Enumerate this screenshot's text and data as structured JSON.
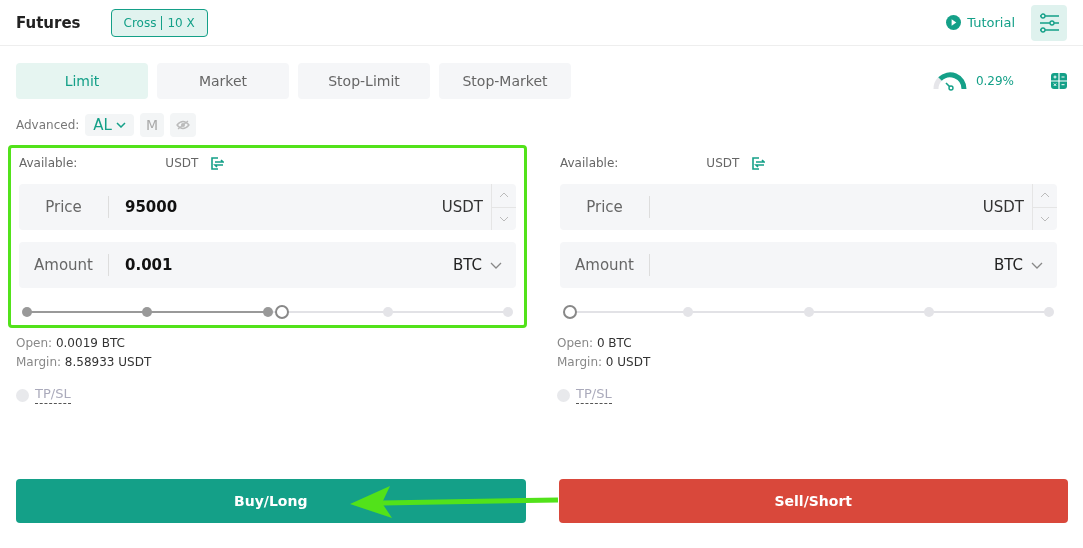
{
  "header": {
    "title": "Futures",
    "margin_mode": "Cross",
    "leverage": "10 X",
    "tutorial": "Tutorial"
  },
  "order_types": [
    {
      "label": "Limit",
      "selected": true
    },
    {
      "label": "Market",
      "selected": false
    },
    {
      "label": "Stop-Limit",
      "selected": false
    },
    {
      "label": "Stop-Market",
      "selected": false
    }
  ],
  "fee_rate": "0.29%",
  "advanced": {
    "label": "Advanced:",
    "mode": "AL",
    "option": "M"
  },
  "panels": [
    {
      "highlighted": true,
      "available_label": "Available:",
      "available_unit": "USDT",
      "price_label": "Price",
      "price_value": "95000",
      "price_unit": "USDT",
      "amount_label": "Amount",
      "amount_value": "0.001",
      "amount_unit": "BTC",
      "level": 0.5,
      "open_label": "Open:",
      "open_value": "0.0019 BTC",
      "margin_label": "Margin:",
      "margin_value": "8.58933 USDT",
      "tpsl": "TP/SL",
      "tpsl_checked": false,
      "action": "Buy/Long",
      "kind": "buy"
    },
    {
      "highlighted": false,
      "available_label": "Available:",
      "available_unit": "USDT",
      "price_label": "Price",
      "price_unit": "USDT",
      "amount_label": "Amount",
      "amount_unit": "BTC",
      "level": 0,
      "open_label": "Open:",
      "open_value": "0 BTC",
      "margin_label": "Margin:",
      "margin_value": "0 USDT",
      "tpsl": "TP/SL",
      "tpsl_checked": false,
      "action": "Sell/Short",
      "kind": "sell"
    }
  ]
}
